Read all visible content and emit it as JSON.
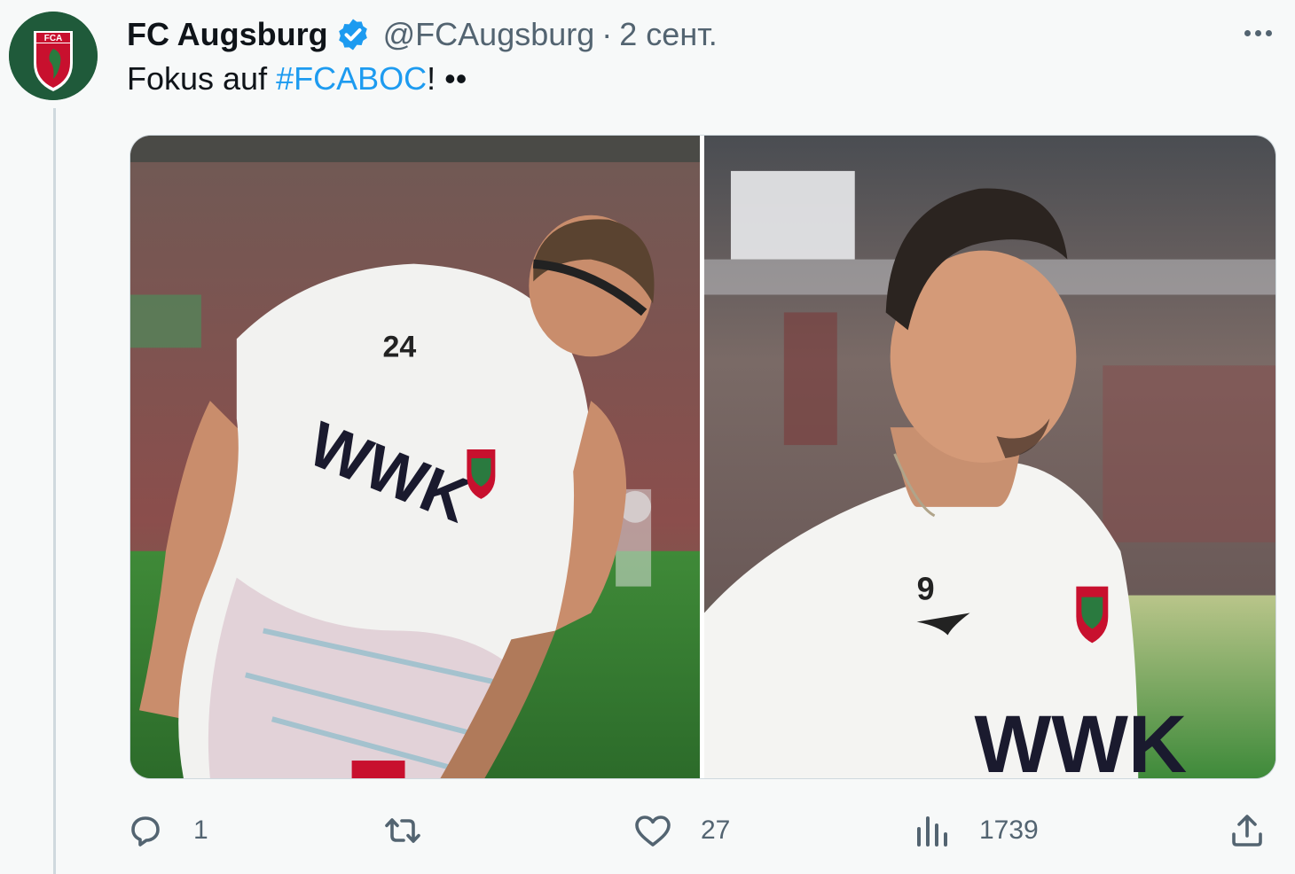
{
  "tweet": {
    "author": {
      "display_name": "FC Augsburg",
      "handle": "@FCAugsburg",
      "verified": true,
      "avatar_icon": "fca-crest-icon",
      "avatar_text": "FCA"
    },
    "separator": "·",
    "date": "2 сент.",
    "text": {
      "prefix": "Fokus auf ",
      "hashtag": "#FCABOC",
      "suffix": "! ••"
    },
    "media": [
      {
        "icon": "photo-player-24-icon",
        "shirt_number": "24",
        "sponsor": "WWK"
      },
      {
        "icon": "photo-player-9-icon",
        "shirt_number": "9",
        "sponsor": "WWK"
      }
    ],
    "actions": {
      "reply": {
        "icon": "reply-icon",
        "count": "1"
      },
      "retweet": {
        "icon": "retweet-icon",
        "count": ""
      },
      "like": {
        "icon": "heart-icon",
        "count": "27"
      },
      "views": {
        "icon": "views-chart-icon",
        "count": "1739"
      },
      "share": {
        "icon": "share-icon"
      }
    },
    "more_icon": "more-horizontal-icon"
  },
  "colors": {
    "text_primary": "#0f1419",
    "text_secondary": "#536471",
    "hashtag": "#1d9bf0",
    "verified_badge": "#1d9bf0",
    "club_green": "#1f5a3a",
    "club_red": "#c8102e"
  }
}
